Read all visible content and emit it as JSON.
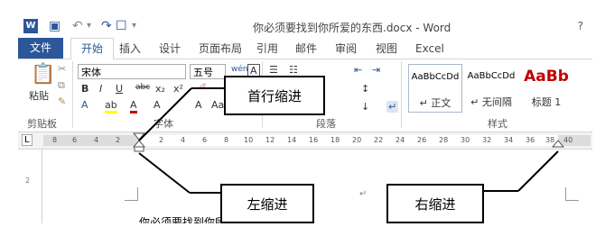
{
  "window": {
    "logo": "W",
    "title": "你必须要找到你所爱的东西.docx - Word",
    "help": "?"
  },
  "quick_access": {
    "save_icon": "save-icon",
    "undo_icon": "undo-icon",
    "redo_icon": "redo-icon",
    "customize": "▾"
  },
  "tabs": [
    "文件",
    "开始",
    "插入",
    "设计",
    "页面布局",
    "引用",
    "邮件",
    "审阅",
    "视图",
    "Excel"
  ],
  "ribbon": {
    "clipboard": {
      "paste": "粘贴",
      "group": "剪贴板"
    },
    "font": {
      "name": "宋体",
      "size": "五号",
      "group": "字体"
    },
    "paragraph": {
      "group": "段落"
    },
    "styles": {
      "group": "样式",
      "items": [
        {
          "sample": "AaBbCcDd",
          "name": "↵ 正文"
        },
        {
          "sample": "AaBbCcDd",
          "name": "↵ 无间隔"
        },
        {
          "sample": "AaBb",
          "name": "标题 1"
        }
      ]
    }
  },
  "ruler": {
    "corner": "L",
    "ticks": [
      "8",
      "6",
      "4",
      "2",
      "",
      "2",
      "4",
      "6",
      "8",
      "10",
      "12",
      "14",
      "16",
      "18",
      "20",
      "22",
      "24",
      "26",
      "28",
      "30",
      "32",
      "34",
      "36",
      "38",
      "40"
    ]
  },
  "document": {
    "text": "你必须要找到你所",
    "paragraph_mark": "↵",
    "vertical_ruler": "2"
  },
  "callouts": {
    "first_line_indent": "首行缩进",
    "left_indent": "左缩进",
    "right_indent": "右缩进"
  },
  "colors": {
    "accent": "#2b579a",
    "highlight": "#ffff00",
    "font_red": "#c00000"
  }
}
